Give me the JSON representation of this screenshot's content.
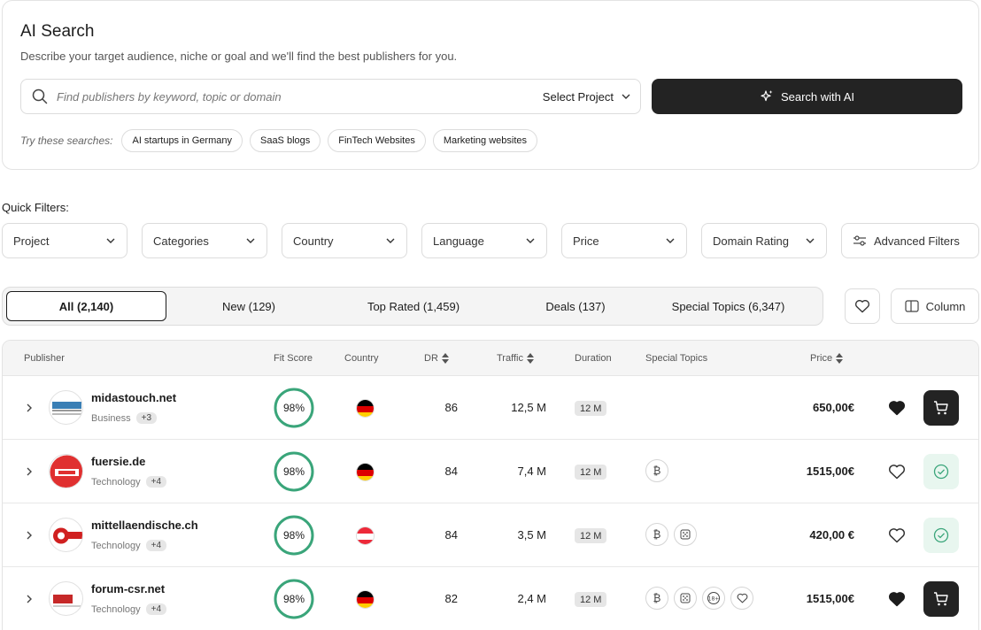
{
  "ai_search": {
    "title": "AI Search",
    "subtitle": "Describe your target audience, niche or goal and we'll find the best publishers for you.",
    "search_placeholder": "Find publishers by keyword, topic or domain",
    "select_project": "Select Project",
    "button_label": "Search with AI",
    "try_label": "Try these searches:",
    "suggestions": [
      "AI startups in Germany",
      "SaaS blogs",
      "FinTech Websites",
      "Marketing websites"
    ]
  },
  "quick_filters": {
    "label": "Quick Filters:",
    "items": [
      "Project",
      "Categories",
      "Country",
      "Language",
      "Price",
      "Domain Rating"
    ],
    "advanced": "Advanced Filters"
  },
  "tabs": [
    "All (2,140)",
    "New (129)",
    "Top Rated (1,459)",
    "Deals (137)",
    "Special Topics (6,347)"
  ],
  "column_button": "Column",
  "table": {
    "headers": {
      "publisher": "Publisher",
      "fit_score": "Fit Score",
      "country": "Country",
      "dr": "DR",
      "traffic": "Traffic",
      "duration": "Duration",
      "special_topics": "Special Topics",
      "price": "Price"
    },
    "rows": [
      {
        "domain": "midastouch.net",
        "category": "Business",
        "more": "+3",
        "fit": "98%",
        "country": "germany",
        "dr": "86",
        "traffic": "12,5 M",
        "duration": "12 M",
        "price": "650,00€",
        "favorited": true,
        "in_cart": false,
        "topics": []
      },
      {
        "domain": "fuersie.de",
        "category": "Technology",
        "more": "+4",
        "fit": "98%",
        "country": "germany",
        "dr": "84",
        "traffic": "7,4 M",
        "duration": "12 M",
        "price": "1515,00€",
        "favorited": false,
        "in_cart": true,
        "topics": [
          "bitcoin-icon"
        ]
      },
      {
        "domain": "mittellaendische.ch",
        "category": "Technology",
        "more": "+4",
        "fit": "98%",
        "country": "austria",
        "dr": "84",
        "traffic": "3,5 M",
        "duration": "12 M",
        "price": "420,00 €",
        "favorited": false,
        "in_cart": true,
        "topics": [
          "bitcoin-icon",
          "casino-icon"
        ]
      },
      {
        "domain": "forum-csr.net",
        "category": "Technology",
        "more": "+4",
        "fit": "98%",
        "country": "germany",
        "dr": "82",
        "traffic": "2,4 M",
        "duration": "12 M",
        "price": "1515,00€",
        "favorited": true,
        "in_cart": false,
        "topics": [
          "bitcoin-icon",
          "casino-icon",
          "adult-18-icon",
          "health-icon"
        ]
      }
    ]
  },
  "colors": {
    "accent_dark": "#232323",
    "fit_green": "#3aa57a",
    "added_bg": "#e8f6ef"
  }
}
